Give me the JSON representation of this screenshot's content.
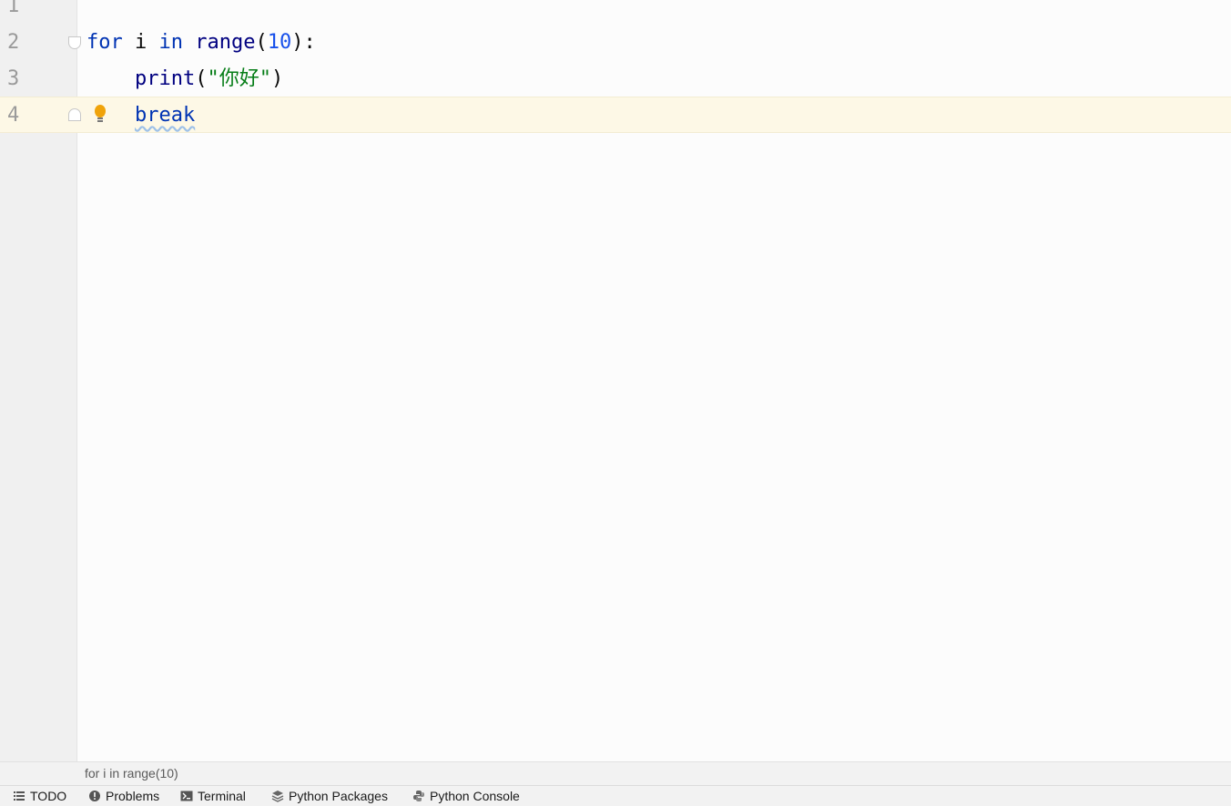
{
  "editor": {
    "lines": [
      {
        "number": "1"
      },
      {
        "number": "2",
        "tokens": {
          "kw_for": "for",
          "var": " i ",
          "kw_in": "in",
          "fn": " range",
          "open": "(",
          "num": "10",
          "close": "):"
        }
      },
      {
        "number": "3",
        "tokens": {
          "indent": "    ",
          "fn": "print",
          "open": "(",
          "str": "\"你好\"",
          "close": ")"
        }
      },
      {
        "number": "4",
        "tokens": {
          "indent": "    ",
          "kw": "break"
        }
      }
    ]
  },
  "breadcrumb": "for i in range(10)",
  "toolwindows": [
    {
      "label": "TODO",
      "icon": "list-icon"
    },
    {
      "label": "Problems",
      "icon": "problems-icon"
    },
    {
      "label": "Terminal",
      "icon": "terminal-icon"
    },
    {
      "label": "Python Packages",
      "icon": "packages-icon"
    },
    {
      "label": "Python Console",
      "icon": "python-console-icon"
    }
  ],
  "colors": {
    "keyword": "#0033b3",
    "number": "#1750eb",
    "string": "#067d17",
    "current_line": "#fdf8e6"
  }
}
